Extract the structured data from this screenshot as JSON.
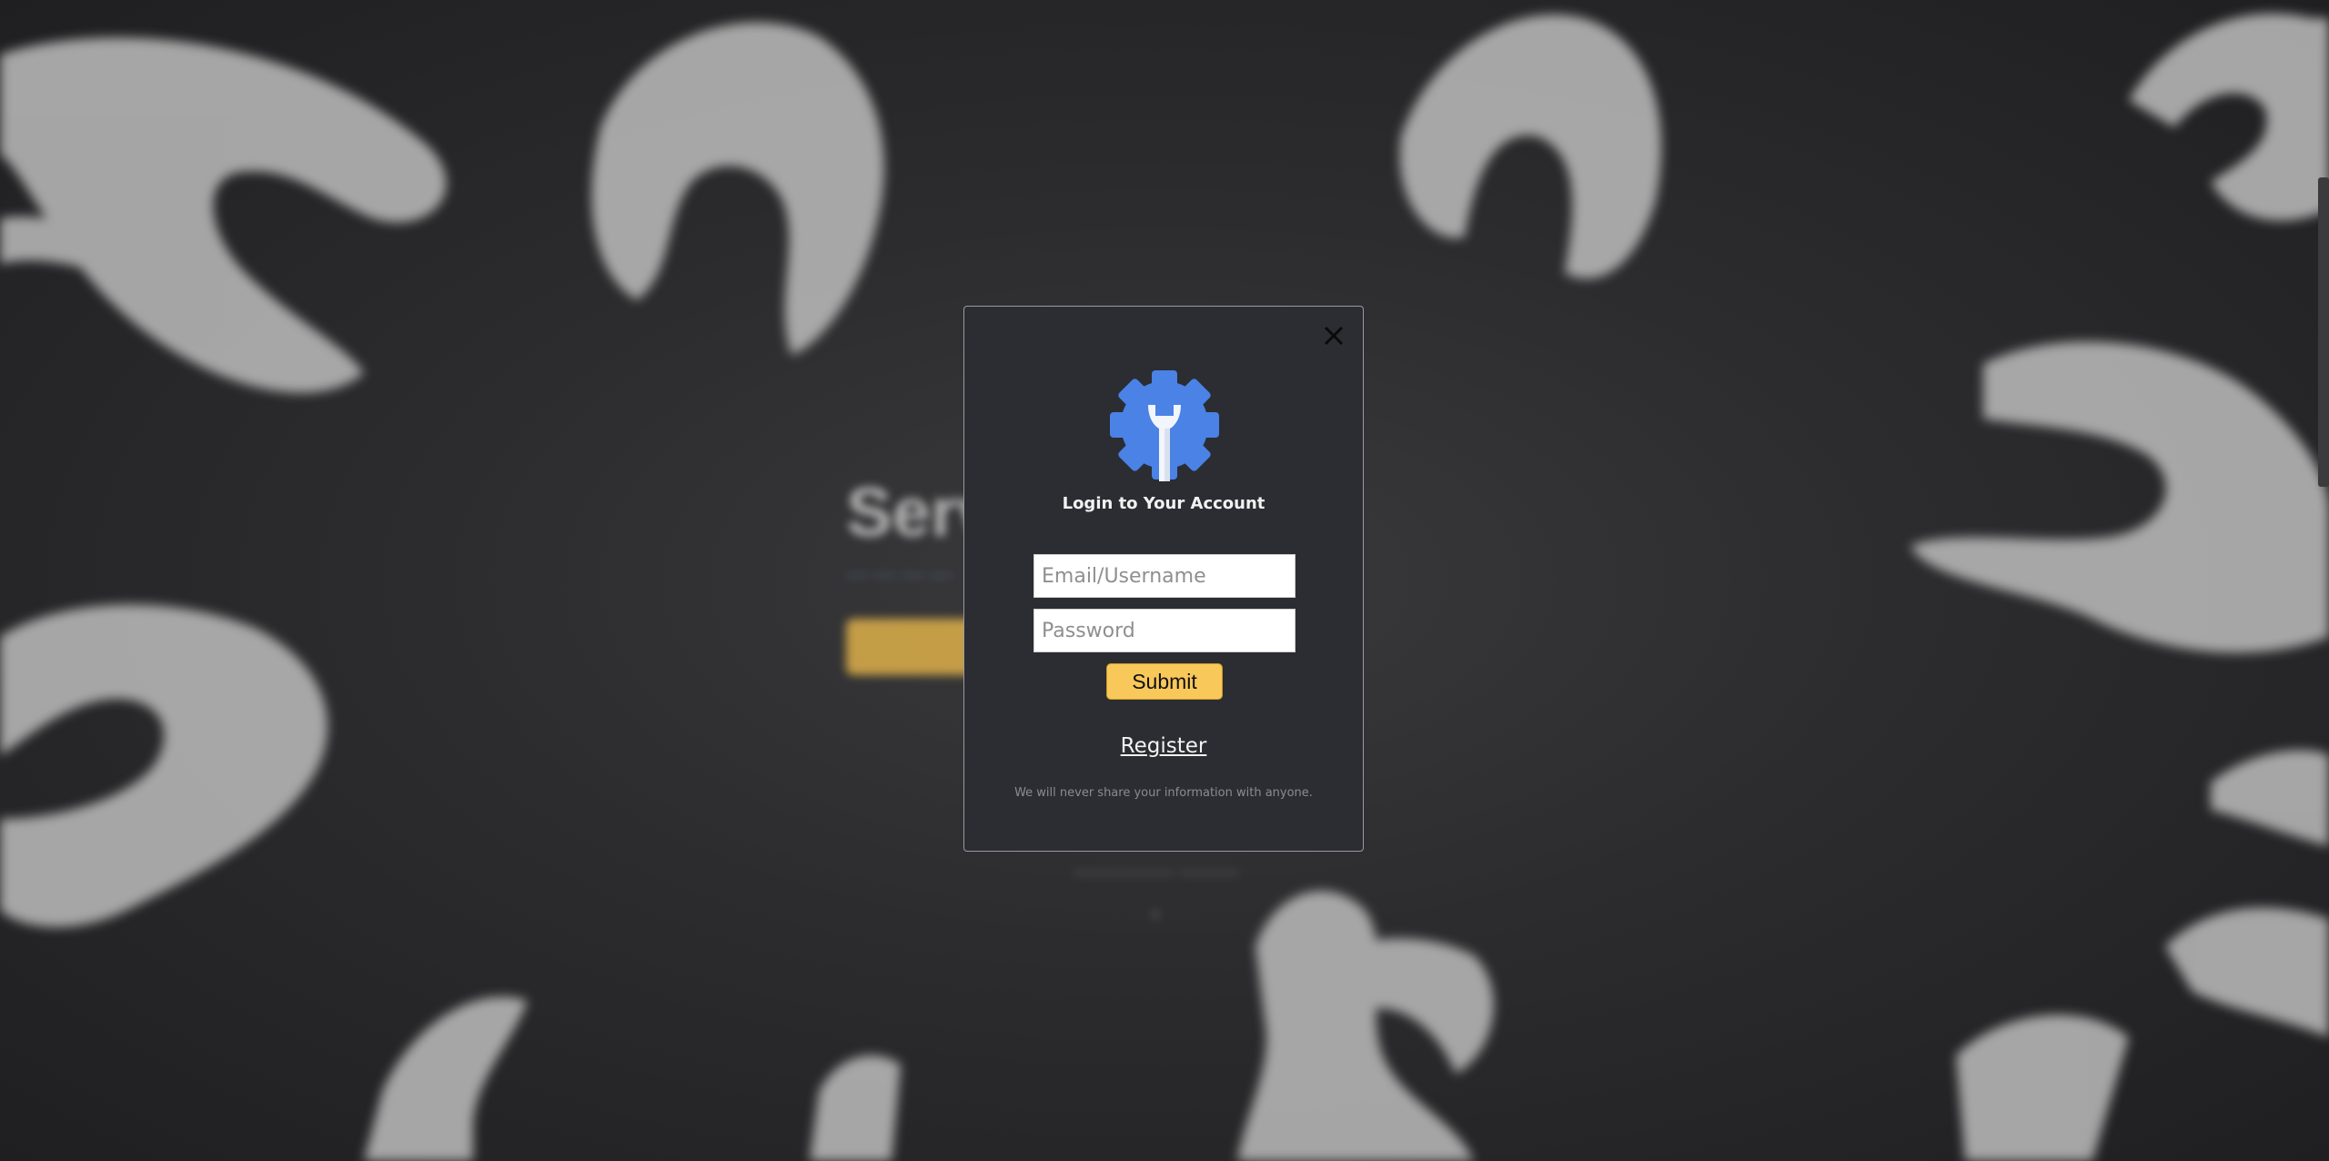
{
  "background": {
    "hero_title": "Serv",
    "hero_subtitle": "— — — —",
    "hero_link": "————— ———",
    "scene": "blurred-wrenches-photo"
  },
  "modal": {
    "close_icon": "close-icon",
    "logo_icon": "gear-wrench-icon",
    "title": "Login to Your Account",
    "email_placeholder": "Email/Username",
    "email_value": "",
    "password_placeholder": "Password",
    "password_value": "",
    "submit_label": "Submit",
    "register_label": "Register",
    "privacy_note": "We will never share your information with anyone."
  },
  "colors": {
    "modal_bg": "#2b2d32",
    "accent": "#f8c85a",
    "logo_blue": "#4a82e6",
    "wrench_white": "#f2f5fb"
  }
}
